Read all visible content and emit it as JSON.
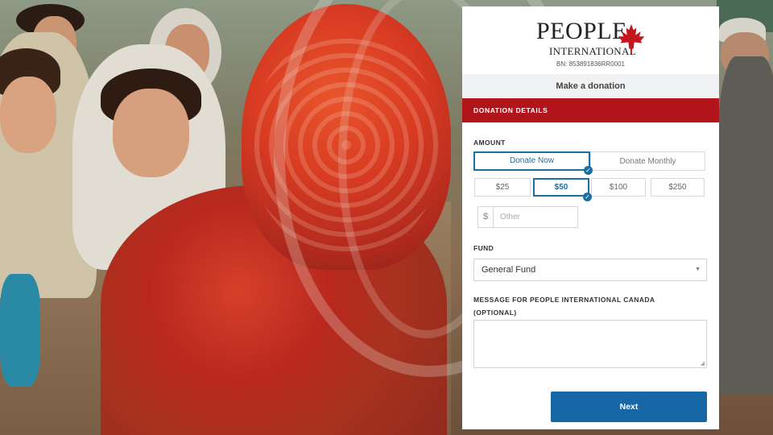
{
  "header": {
    "logo_people": "PEOPLE",
    "logo_international": "INTERNATIONAL",
    "bn": "BN: 853891836RR0001",
    "make_donation": "Make a donation"
  },
  "details": {
    "title": "DONATION DETAILS",
    "amount_label": "AMOUNT",
    "frequency": {
      "now": "Donate Now",
      "monthly": "Donate Monthly",
      "selected": "now"
    },
    "amounts": [
      "$25",
      "$50",
      "$100",
      "$250"
    ],
    "selected_amount": "$50",
    "other": {
      "currency": "$",
      "placeholder": "Other"
    },
    "fund_label": "FUND",
    "fund_value": "General Fund",
    "message_label": "MESSAGE FOR PEOPLE INTERNATIONAL CANADA (OPTIONAL)",
    "next_label": "Next"
  },
  "colors": {
    "brand_red": "#b1141b",
    "accent_blue": "#1d6ea0",
    "button_blue": "#1667a5"
  },
  "icons": {
    "logo": "maple-leaf-icon",
    "check": "check-icon",
    "select": "caret-down-icon"
  }
}
